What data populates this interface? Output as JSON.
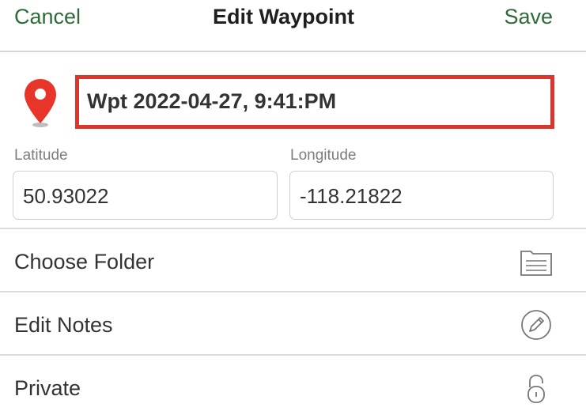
{
  "navbar": {
    "cancel_label": "Cancel",
    "title": "Edit Waypoint",
    "save_label": "Save"
  },
  "waypoint": {
    "name": "Wpt 2022-04-27, 9:41:PM",
    "pin_icon": "map-pin-icon",
    "pin_color": "#e8352a",
    "highlight_color": "#d9372b"
  },
  "coordinates": {
    "latitude_label": "Latitude",
    "latitude_value": "50.93022",
    "longitude_label": "Longitude",
    "longitude_value": "-118.21822"
  },
  "rows": [
    {
      "label": "Choose Folder",
      "icon": "folder-icon"
    },
    {
      "label": "Edit Notes",
      "icon": "pencil-circle-icon"
    },
    {
      "label": "Private",
      "icon": "lock-icon"
    }
  ],
  "colors": {
    "accent": "#2f6b39",
    "divider": "#dcdcdc"
  }
}
